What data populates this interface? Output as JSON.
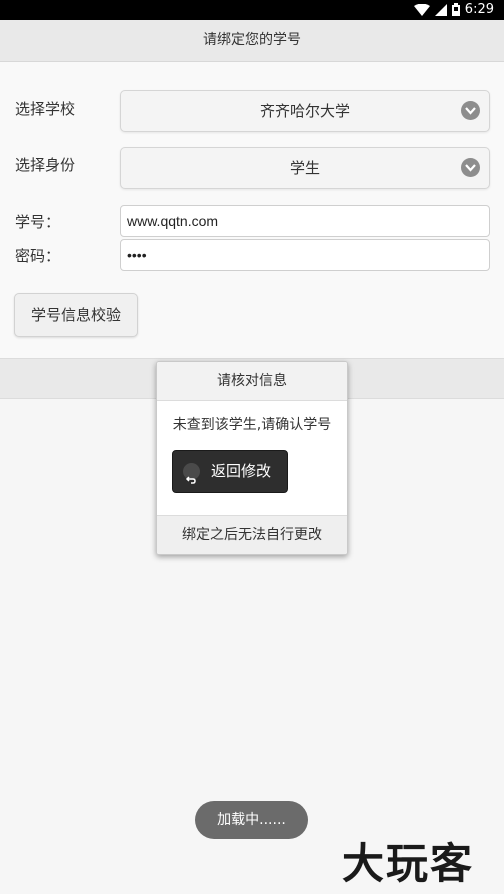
{
  "status_bar": {
    "time": "6:29"
  },
  "header": {
    "title": "请绑定您的学号"
  },
  "form": {
    "school_label": "选择学校",
    "school_value": "齐齐哈尔大学",
    "role_label": "选择身份",
    "role_value": "学生",
    "student_id_label": "学号：",
    "student_id_value": "www.qqtn.com",
    "password_label": "密码：",
    "password_value": "••••",
    "verify_button": "学号信息校验"
  },
  "dialog": {
    "title": "请核对信息",
    "message": "未查到该学生,请确认学号",
    "back_button": "返回修改",
    "footer": "绑定之后无法自行更改"
  },
  "toast": {
    "text": "加载中......"
  },
  "watermark": {
    "text": "大玩客"
  }
}
